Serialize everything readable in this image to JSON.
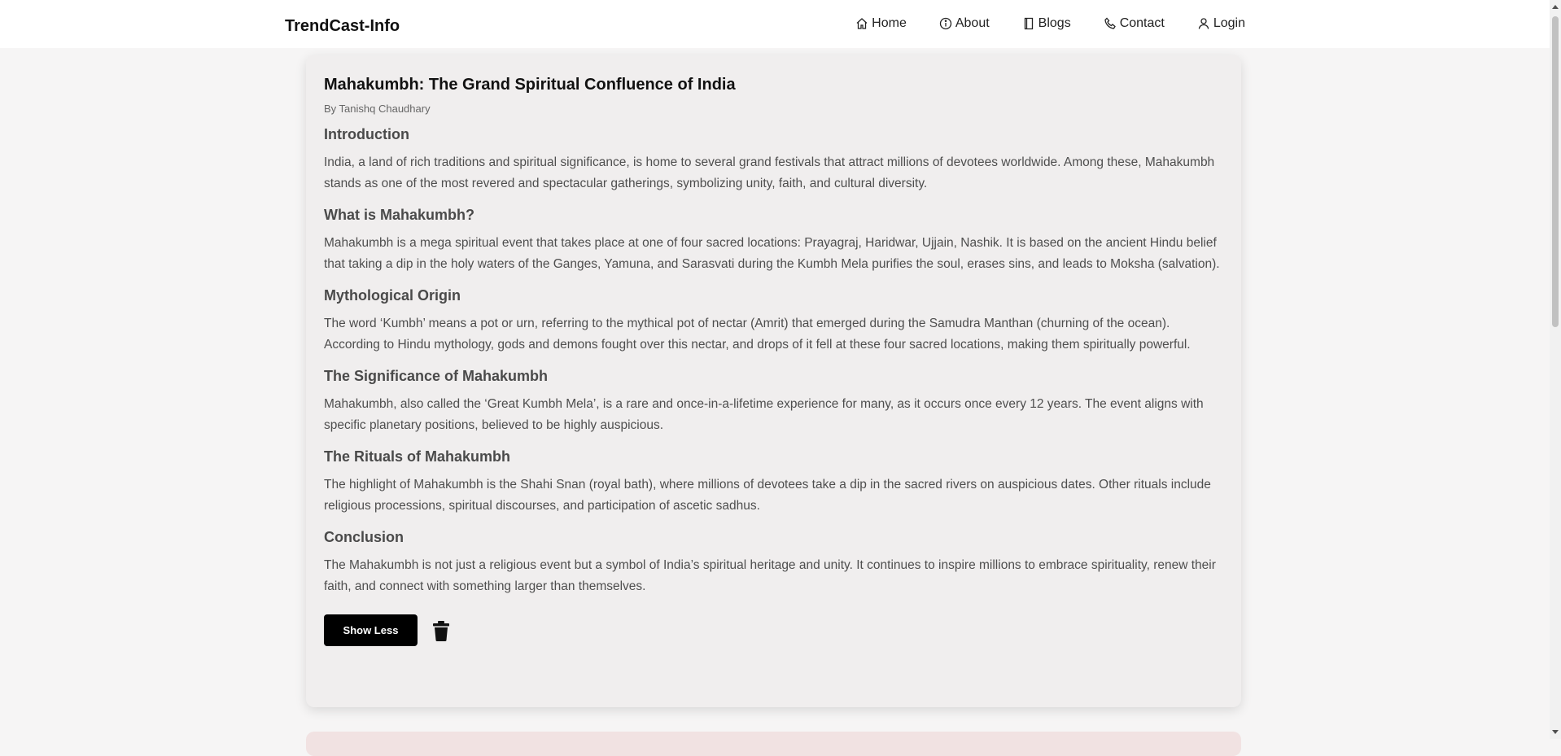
{
  "brand": "TrendCast-Info",
  "nav": [
    {
      "label": "Home",
      "icon": "home-icon"
    },
    {
      "label": "About",
      "icon": "info-icon"
    },
    {
      "label": "Blogs",
      "icon": "book-icon"
    },
    {
      "label": "Contact",
      "icon": "phone-icon"
    },
    {
      "label": "Login",
      "icon": "user-icon"
    }
  ],
  "post": {
    "title": "Mahakumbh: The Grand Spiritual Confluence of India",
    "author": "By Tanishq Chaudhary",
    "sections": [
      {
        "heading": "Introduction",
        "body": "India, a land of rich traditions and spiritual significance, is home to several grand festivals that attract millions of devotees worldwide. Among these, Mahakumbh stands as one of the most revered and spectacular gatherings, symbolizing unity, faith, and cultural diversity."
      },
      {
        "heading": "What is Mahakumbh?",
        "body": "Mahakumbh is a mega spiritual event that takes place at one of four sacred locations: Prayagraj, Haridwar, Ujjain, Nashik. It is based on the ancient Hindu belief that taking a dip in the holy waters of the Ganges, Yamuna, and Sarasvati during the Kumbh Mela purifies the soul, erases sins, and leads to Moksha (salvation)."
      },
      {
        "heading": "Mythological Origin",
        "body": "The word ‘Kumbh’ means a pot or urn, referring to the mythical pot of nectar (Amrit) that emerged during the Samudra Manthan (churning of the ocean). According to Hindu mythology, gods and demons fought over this nectar, and drops of it fell at these four sacred locations, making them spiritually powerful."
      },
      {
        "heading": "The Significance of Mahakumbh",
        "body": "Mahakumbh, also called the ‘Great Kumbh Mela’, is a rare and once-in-a-lifetime experience for many, as it occurs once every 12 years. The event aligns with specific planetary positions, believed to be highly auspicious."
      },
      {
        "heading": "The Rituals of Mahakumbh",
        "body": "The highlight of Mahakumbh is the Shahi Snan (royal bath), where millions of devotees take a dip in the sacred rivers on auspicious dates. Other rituals include religious processions, spiritual discourses, and participation of ascetic sadhus."
      },
      {
        "heading": "Conclusion",
        "body": "The Mahakumbh is not just a religious event but a symbol of India’s spiritual heritage and unity. It continues to inspire millions to embrace spirituality, renew their faith, and connect with something larger than themselves."
      }
    ],
    "show_less_label": "Show Less",
    "delete_icon": "trash-icon"
  }
}
